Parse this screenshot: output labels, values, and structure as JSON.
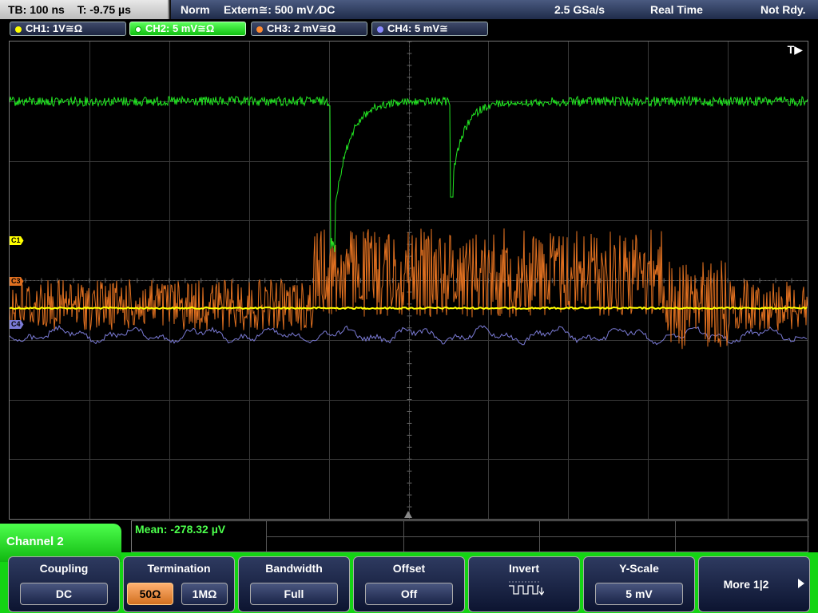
{
  "status": {
    "timebase": "TB: 100 ns",
    "trigger_time": "T: -9.75 µs",
    "trigger_mode": "Norm",
    "trigger_source": "Extern≅: 500 mV ⁄DC",
    "sample_rate": "2.5 GSa/s",
    "acq_mode": "Real Time",
    "ready_state": "Not Rdy."
  },
  "channels": [
    {
      "label": "CH1: 1V≅Ω",
      "color": "#ffff00",
      "marker": "C1"
    },
    {
      "label": "CH2: 5 mV≅Ω",
      "color": "#33ff33",
      "marker": "C2"
    },
    {
      "label": "CH3: 2 mV≅Ω",
      "color": "#ff8a30",
      "marker": "C3"
    },
    {
      "label": "CH4: 5 mV≅",
      "color": "#8a8aff",
      "marker": "C4"
    }
  ],
  "trigger_indicator": "T▶",
  "measurement": {
    "mean": "Mean: -278.32 µV"
  },
  "menu": {
    "title": "Channel 2",
    "coupling": {
      "title": "Coupling",
      "value": "DC"
    },
    "termination": {
      "title": "Termination",
      "opt1": "50Ω",
      "opt2": "1MΩ"
    },
    "bandwidth": {
      "title": "Bandwidth",
      "value": "Full"
    },
    "offset": {
      "title": "Offset",
      "value": "Off"
    },
    "invert": {
      "title": "Invert"
    },
    "yscale": {
      "title": "Y-Scale",
      "value": "5 mV"
    },
    "more": {
      "label": "More 1|2"
    }
  },
  "colors": {
    "ch1": "#ffff00",
    "ch2": "#33ff33",
    "ch3": "#e07020",
    "ch4": "#7b7bd6",
    "accent": "#14d414"
  }
}
